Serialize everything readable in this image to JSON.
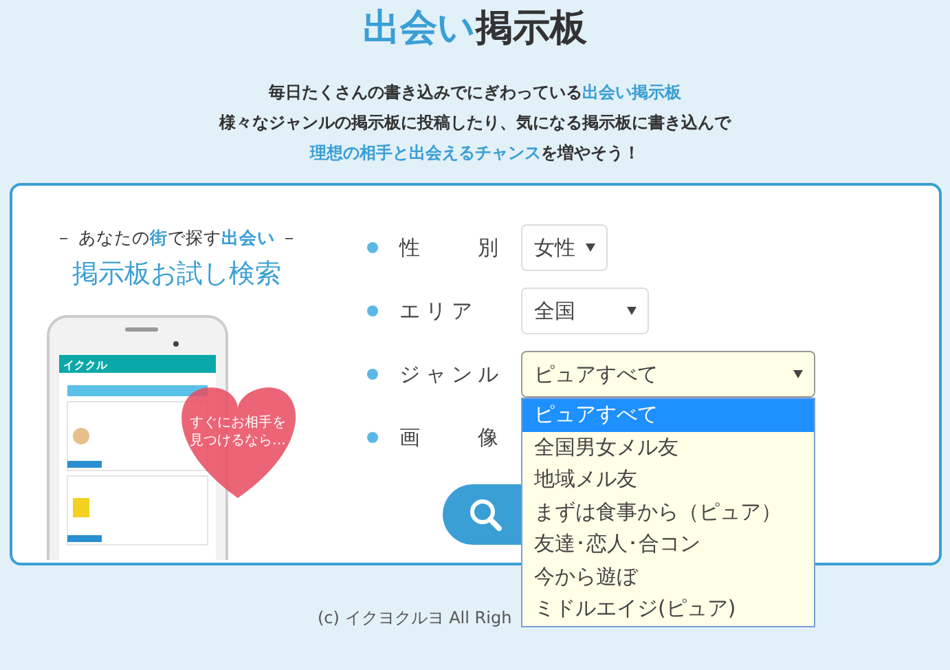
{
  "header": {
    "title": "**出会い**掲示板"
  },
  "intro": [
    "毎日たくさんの書き込みでにぎわっている**出会い掲示板**",
    "様々なジャンルの掲示板に投稿したり、気になる掲示板に書き込んで",
    "**理想の相手と出会えるチャンス**を増やそう！"
  ],
  "promo": {
    "tagline": "－ あなたの**街**で探す**出会い** －",
    "title": "掲示板お試し検索",
    "app_name": "イククル",
    "heart_caption": [
      "すぐにお相手を",
      "見つけるなら…"
    ]
  },
  "form": {
    "fields": [
      {
        "label": "性　　別",
        "value": "女性",
        "open": false
      },
      {
        "label": "エリア",
        "value": "全国",
        "open": false
      },
      {
        "label": "ジャンル",
        "value": "ピュアすべて",
        "open": true
      },
      {
        "label": "画　　像"
      }
    ],
    "dropdown": [
      {
        "label": "ピュアすべて",
        "selected": true
      },
      {
        "label": "全国男女メル友",
        "selected": false
      },
      {
        "label": "地域メル友",
        "selected": false
      },
      {
        "label": "まずは食事から（ピュア）",
        "selected": false
      },
      {
        "label": "友達･恋人･合コン",
        "selected": false
      },
      {
        "label": "今から遊ぼ",
        "selected": false
      },
      {
        "label": "ミドルエイジ(ピュア)",
        "selected": false
      }
    ]
  },
  "footer": {
    "copyright": "(c) イクヨクルヨ All Righ"
  }
}
